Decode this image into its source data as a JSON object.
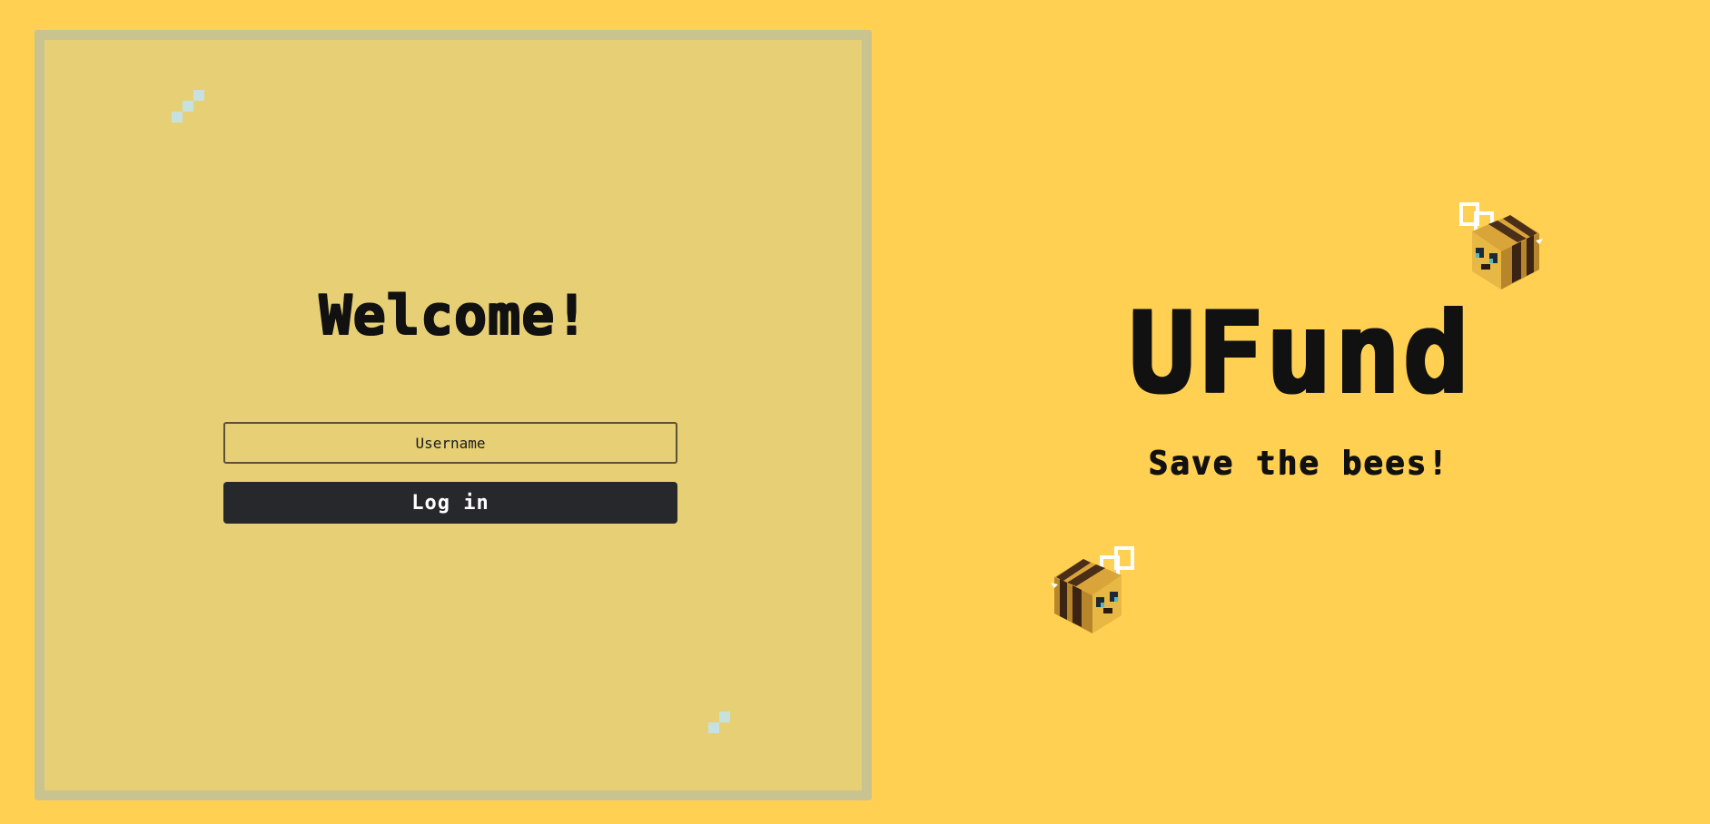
{
  "login": {
    "title": "Welcome!",
    "username_placeholder": "Username",
    "username_value": "",
    "login_label": "Log in"
  },
  "brand": {
    "name": "UFund",
    "tagline": "Save the bees!"
  },
  "icons": {
    "sparkle": "sparkle-icon",
    "bee": "bee-icon"
  },
  "colors": {
    "page_background": "#ffd051",
    "panel_background": "#e6cf74",
    "panel_border": "#c9c48f",
    "button_background": "#27282b",
    "button_text": "#ffffff",
    "text": "#111111"
  }
}
